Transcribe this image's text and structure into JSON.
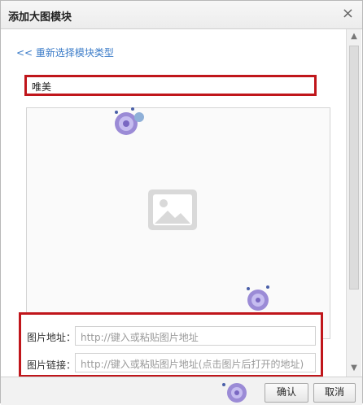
{
  "dialog": {
    "title": "添加大图模块",
    "close_label": "×"
  },
  "content": {
    "back_link": "<< 重新选择模块类型",
    "module_name": "唯美"
  },
  "form": {
    "image_url_label": "图片地址：",
    "image_url_placeholder": "http://键入或粘贴图片地址",
    "image_link_label": "图片链接：",
    "image_link_placeholder": "http://键入或粘贴图片地址(点击图片后打开的地址)"
  },
  "footer": {
    "confirm_label": "确认",
    "cancel_label": "取消"
  },
  "scrollbar": {
    "up_arrow": "▲",
    "down_arrow": "▼"
  },
  "colors": {
    "highlight": "#c0161b",
    "link": "#3a7bc8"
  },
  "icons": {
    "image_placeholder": "image-placeholder-icon",
    "close": "close-icon",
    "decorations": "rose-sticker-icon"
  }
}
